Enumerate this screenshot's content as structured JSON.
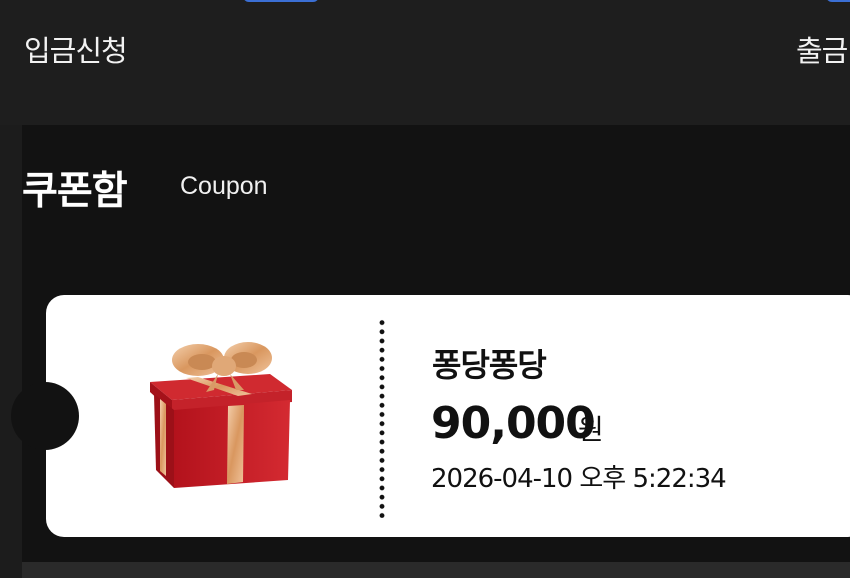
{
  "nav": {
    "deposit_label": "입금신청",
    "withdraw_label": "출금"
  },
  "panel": {
    "title": "쿠폰함",
    "subtitle": "Coupon"
  },
  "coupon": {
    "name": "퐁당퐁당",
    "amount": "90,000",
    "unit": "원",
    "date": "2026-04-10 오후 5:22:34",
    "icon": "gift-box-icon"
  },
  "colors": {
    "accent_blue": "#3b6fd4",
    "gift_red": "#c8232c",
    "ribbon_gold": "#e8b38a"
  }
}
